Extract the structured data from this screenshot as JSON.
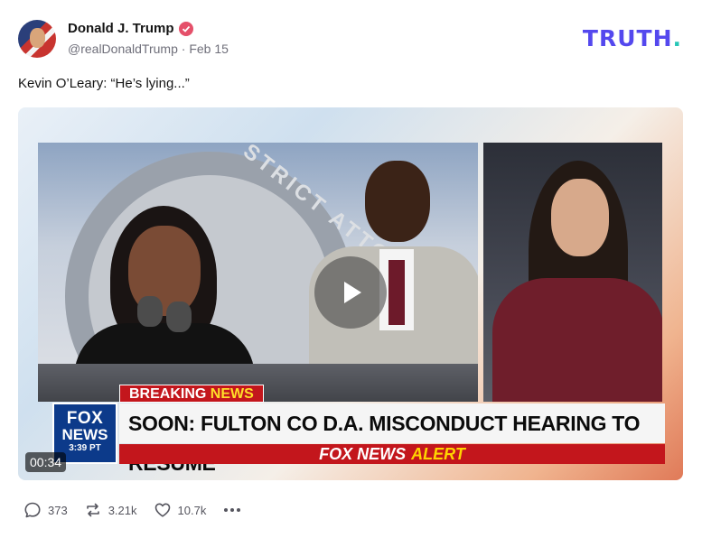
{
  "author": {
    "name": "Donald J. Trump",
    "handle": "@realDonaldTrump",
    "separator": " · ",
    "date": "Feb 15"
  },
  "brand": {
    "text": "TRUTH",
    "dot": "."
  },
  "post": {
    "text": "Kevin O’Leary: “He’s lying...”"
  },
  "video": {
    "duration": "00:34",
    "seal_text": "STRICT ATTORNEY",
    "chyron": {
      "breaking_prefix": "BREAKING",
      "breaking_suffix": "NEWS",
      "headline": "SOON: FULTON CO D.A. MISCONDUCT HEARING TO RESUME",
      "alert_prefix": "FOX NEWS",
      "alert_suffix": "ALERT",
      "logo_line1": "FOX",
      "logo_line2": "NEWS",
      "logo_time": "3:39 PT"
    }
  },
  "actions": {
    "replies": "373",
    "retruths": "3.21k",
    "likes": "10.7k"
  },
  "colors": {
    "brand": "#5448ee",
    "brand_dot": "#27c6b7",
    "verified": "#e5506a",
    "breaking_red": "#c3161c",
    "alert_yellow": "#ffd400",
    "fox_blue": "#0c3a8a"
  },
  "icons": [
    "verified-badge-icon",
    "play-icon",
    "reply-icon",
    "retruth-icon",
    "like-icon",
    "more-icon"
  ]
}
